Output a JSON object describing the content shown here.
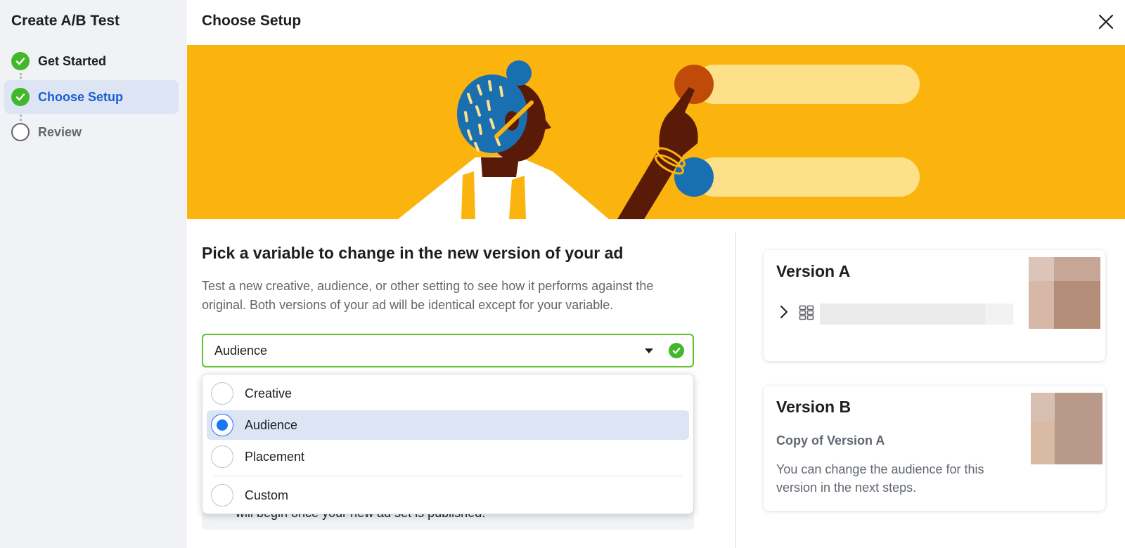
{
  "sidebar": {
    "title": "Create A/B Test",
    "steps": [
      {
        "label": "Get Started",
        "state": "complete"
      },
      {
        "label": "Choose Setup",
        "state": "active"
      },
      {
        "label": "Review",
        "state": "pending"
      }
    ]
  },
  "header": {
    "title": "Choose Setup",
    "close_icon": "close-icon"
  },
  "main": {
    "heading": "Pick a variable to change in the new version of your ad",
    "description": "Test a new creative, audience, or other setting to see how it performs against the original. Both versions of your ad will be identical except for your variable.",
    "variable_select": {
      "value": "Audience",
      "options": [
        "Creative",
        "Audience",
        "Placement",
        "Custom"
      ],
      "selected_index": 1
    },
    "partial_notice_text": "will begin once your new ad set is published."
  },
  "versions": {
    "a": {
      "title": "Version A"
    },
    "b": {
      "title": "Version B",
      "subtitle": "Copy of Version A",
      "description": "You can change the audience for this version in the next steps."
    }
  },
  "colors": {
    "banner": "#fbb40d",
    "success": "#42b72a",
    "active_blue": "#1b5fd3",
    "radio_blue": "#1877f2"
  }
}
